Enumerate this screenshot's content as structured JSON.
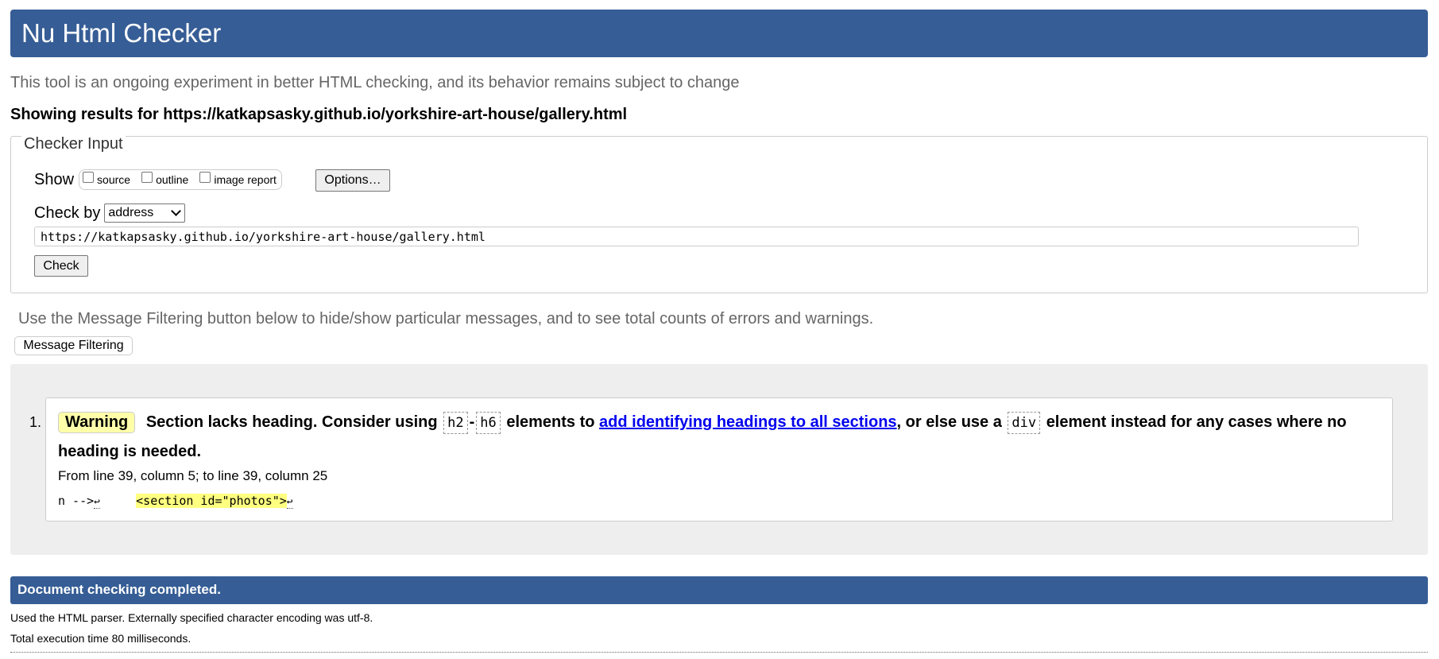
{
  "header": {
    "title": "Nu Html Checker"
  },
  "intro": "This tool is an ongoing experiment in better HTML checking, and its behavior remains subject to change",
  "showing_results": "Showing results for https://katkapsasky.github.io/yorkshire-art-house/gallery.html",
  "checker_input": {
    "legend": "Checker Input",
    "show_label": "Show",
    "show_options": [
      {
        "label": "source",
        "checked": false
      },
      {
        "label": "outline",
        "checked": false
      },
      {
        "label": "image report",
        "checked": false
      }
    ],
    "options_button": "Options…",
    "check_by_label": "Check by",
    "check_by_selected": "address",
    "url_value": "https://katkapsasky.github.io/yorkshire-art-house/gallery.html",
    "check_button": "Check"
  },
  "filter_note": "Use the Message Filtering button below to hide/show particular messages, and to see total counts of errors and warnings.",
  "filter_button": "Message Filtering",
  "messages": [
    {
      "number": "1.",
      "type": "Warning",
      "text_1": "Section lacks heading. Consider using",
      "code_1": "h2",
      "dash": "-",
      "code_2": "h6",
      "text_2": "elements to",
      "link": "add identifying headings to all sections",
      "text_3": ", or else use a",
      "code_3": "div",
      "text_4": "element instead for any cases where no heading is needed.",
      "location": "From line 39, column 5; to line 39, column 25",
      "extract_before": "n -->",
      "extract_gap": "     ",
      "extract_highlight": "<section id=\"photos\">",
      "return_glyph": "↩"
    }
  ],
  "completion": {
    "title": "Document checking completed.",
    "parser_note": "Used the HTML parser. Externally specified character encoding was utf-8.",
    "execution_time": "Total execution time 80 milliseconds."
  },
  "colors": {
    "header_bg": "#365d95",
    "warning_badge": "#ffffaa",
    "highlight": "#ffff80"
  }
}
